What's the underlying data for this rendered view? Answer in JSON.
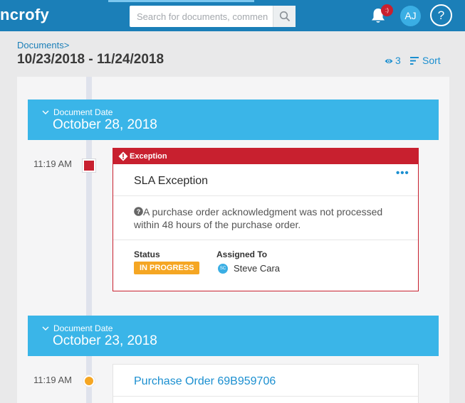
{
  "app": {
    "brand": "ncrofy"
  },
  "search": {
    "placeholder": "Search for documents, commen"
  },
  "notifications": {
    "badge": ":)"
  },
  "user": {
    "initials": "AJ"
  },
  "help": {
    "label": "?"
  },
  "header": {
    "breadcrumb": "Documents>",
    "title": "10/23/2018 - 11/24/2018",
    "watch_count": "3",
    "sort_label": "Sort"
  },
  "timeline": {
    "groups": [
      {
        "label": "Document Date",
        "date": "October 28, 2018",
        "entries": [
          {
            "time": "11:19 AM",
            "type_label": "Exception",
            "title": "SLA Exception",
            "more": "•••",
            "description": "A purchase order acknowledgment was not processed within 48 hours of the purchase order.",
            "status_label": "Status",
            "status": "IN PROGRESS",
            "assigned_label": "Assigned To",
            "assignee_initials": "SC",
            "assignee": "Steve Cara"
          }
        ]
      },
      {
        "label": "Document Date",
        "date": "October 23, 2018",
        "entries": [
          {
            "time": "11:19 AM",
            "title": "Purchase Order 69B959706"
          }
        ]
      }
    ]
  },
  "colors": {
    "topbar": "#1b7fb8",
    "date_header": "#3ab5e8",
    "exception": "#c8202f",
    "status_in_progress": "#f5a623",
    "link": "#1b8fd0"
  },
  "icons": [
    "search-icon",
    "bell-icon",
    "eye-icon",
    "sort-icon",
    "chevron-down-icon",
    "warning-icon",
    "help-circle-icon",
    "info-icon"
  ]
}
